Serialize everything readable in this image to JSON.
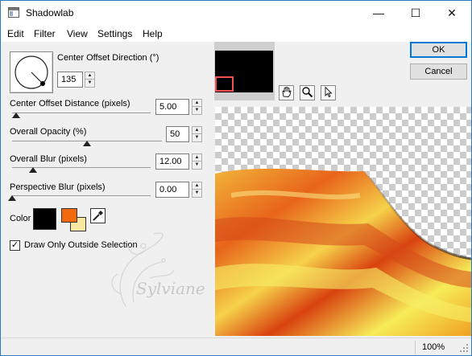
{
  "window": {
    "title": "Shadowlab"
  },
  "window_controls": {
    "minimize": "—",
    "maximize": "☐",
    "close": "✕"
  },
  "menu": [
    "Edit",
    "Filter",
    "View",
    "Settings",
    "Help"
  ],
  "controls": {
    "direction": {
      "label": "Center Offset Direction (°)",
      "value": "135"
    },
    "distance": {
      "label": "Center Offset Distance (pixels)",
      "value": "5.00",
      "level": 0.03
    },
    "opacity": {
      "label": "Overall Opacity (%)",
      "value": "50",
      "level": 0.5
    },
    "blur": {
      "label": "Overall Blur (pixels)",
      "value": "12.00",
      "level": 0.15
    },
    "perspective": {
      "label": "Perspective Blur (pixels)",
      "value": "0.00",
      "level": 0.0
    },
    "color": {
      "label": "Color",
      "primary": "#000000",
      "fg": "#f26a10",
      "bg": "#f7e7a1"
    },
    "draw_outside": {
      "label": "Draw Only Outside Selection",
      "checked": true
    }
  },
  "buttons": {
    "ok": "OK",
    "cancel": "Cancel"
  },
  "tools": [
    "hand-icon",
    "zoom-icon",
    "pointer-icon"
  ],
  "watermark": {
    "text": "Sylviane"
  },
  "status": {
    "zoom": "100%"
  },
  "colors": {
    "accent": "#0078d7",
    "border": "#2b79c2"
  }
}
